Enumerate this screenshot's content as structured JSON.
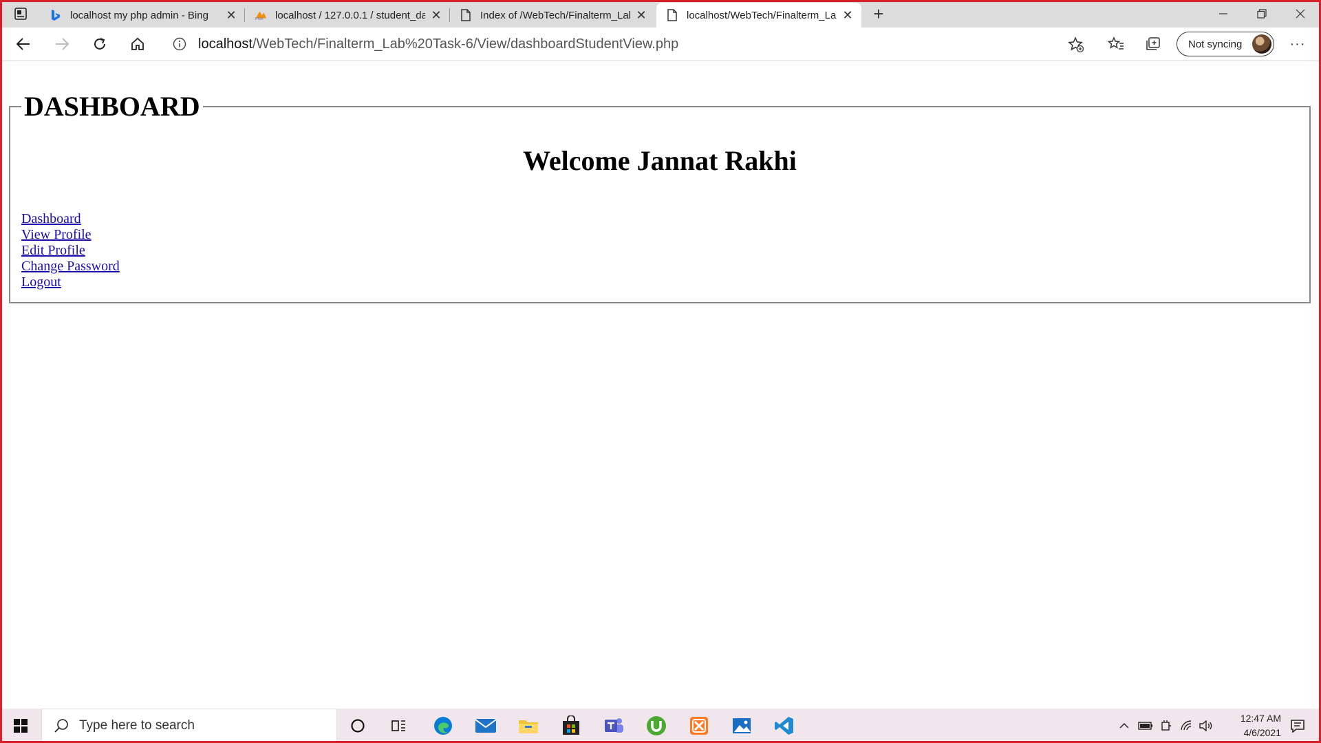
{
  "browser": {
    "tabs": [
      {
        "title": "localhost my php admin - Bing",
        "favicon": "bing-icon"
      },
      {
        "title": "localhost / 127.0.0.1 / student_da",
        "favicon": "phpmyadmin-icon"
      },
      {
        "title": "Index of /WebTech/Finalterm_Lab",
        "favicon": "page-icon"
      },
      {
        "title": "localhost/WebTech/Finalterm_Lab",
        "favicon": "page-icon"
      }
    ],
    "url_host": "localhost",
    "url_path": "/WebTech/Finalterm_Lab%20Task-6/View/dashboardStudentView.php",
    "sync_label": "Not syncing"
  },
  "page": {
    "legend": "DASHBOARD",
    "welcome": "Welcome Jannat Rakhi",
    "links": [
      "Dashboard",
      "View Profile",
      "Edit Profile",
      "Change Password",
      "Logout"
    ]
  },
  "taskbar": {
    "search_placeholder": "Type here to search",
    "time": "12:47 AM",
    "date": "4/6/2021",
    "apps": [
      "cortana-icon",
      "task-view-icon",
      "edge-icon",
      "mail-icon",
      "file-explorer-icon",
      "store-icon",
      "teams-icon",
      "utorrent-icon",
      "xampp-icon",
      "photos-icon",
      "vscode-icon"
    ]
  },
  "colors": {
    "frame": "#d6202a",
    "link": "#1a0dab",
    "taskbar": "#f1e6ec",
    "tabstrip": "#dcdcdc"
  }
}
